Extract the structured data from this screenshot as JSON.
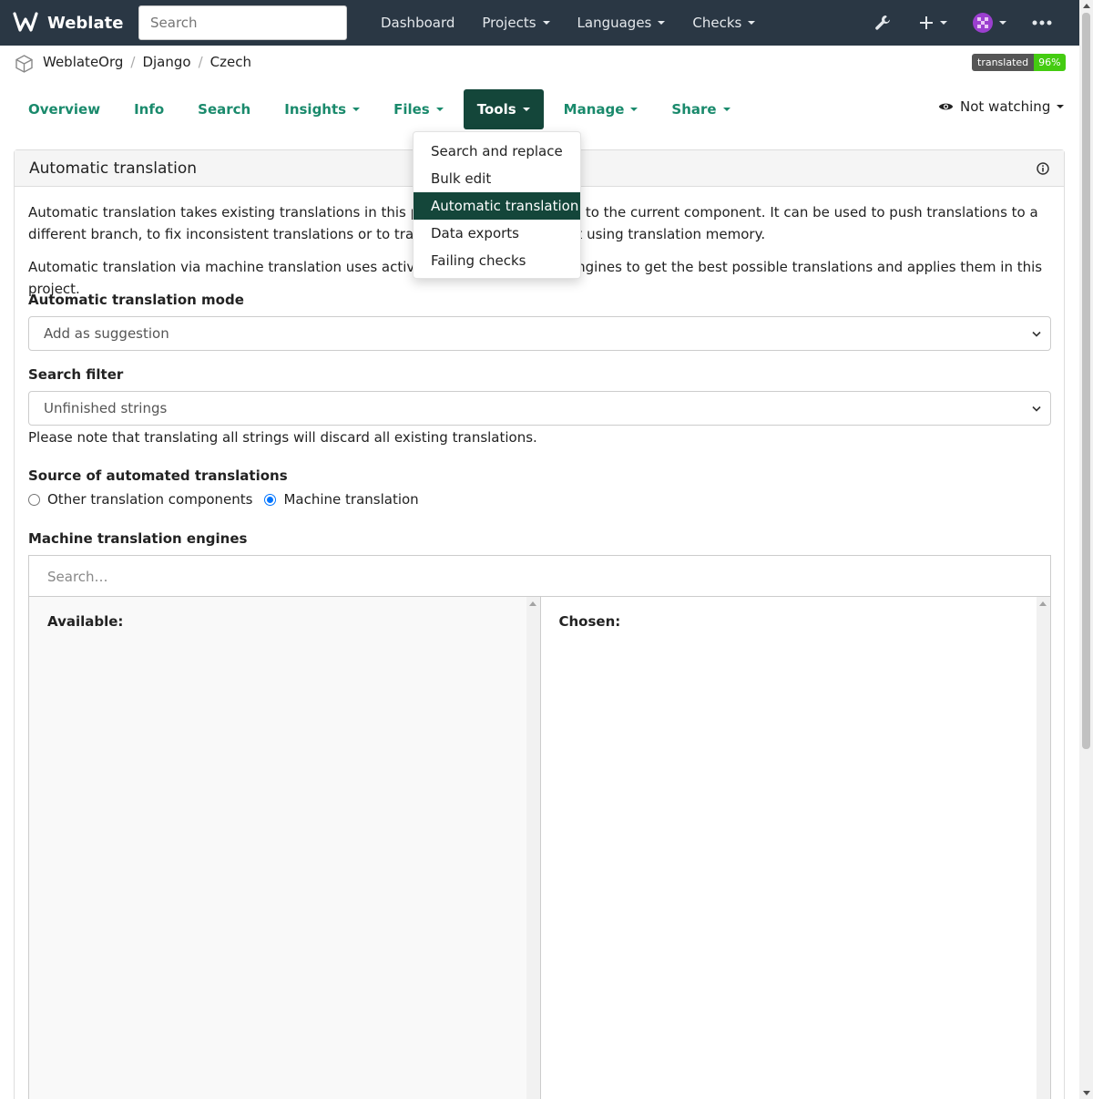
{
  "navbar": {
    "brand": "Weblate",
    "search_placeholder": "Search",
    "menu": [
      {
        "label": "Dashboard",
        "has_caret": false
      },
      {
        "label": "Projects",
        "has_caret": true
      },
      {
        "label": "Languages",
        "has_caret": true
      },
      {
        "label": "Checks",
        "has_caret": true
      }
    ],
    "icons": [
      "wrench-icon",
      "plus-icon",
      "avatar",
      "more-icon"
    ]
  },
  "breadcrumb": {
    "items": [
      "WeblateOrg",
      "Django",
      "Czech"
    ],
    "badge_label": "translated",
    "badge_value": "96%"
  },
  "tabs": [
    {
      "label": "Overview",
      "caret": false,
      "active": false
    },
    {
      "label": "Info",
      "caret": false,
      "active": false
    },
    {
      "label": "Search",
      "caret": false,
      "active": false
    },
    {
      "label": "Insights",
      "caret": true,
      "active": false
    },
    {
      "label": "Files",
      "caret": true,
      "active": false
    },
    {
      "label": "Tools",
      "caret": true,
      "active": true
    },
    {
      "label": "Manage",
      "caret": true,
      "active": false
    },
    {
      "label": "Share",
      "caret": true,
      "active": false
    }
  ],
  "watch": {
    "label": "Not watching"
  },
  "tools_menu": {
    "items": [
      "Search and replace",
      "Bulk edit",
      "Automatic translation",
      "Data exports",
      "Failing checks"
    ],
    "active_index": 2
  },
  "panel": {
    "title": "Automatic translation",
    "para1": "Automatic translation takes existing translations in this project and applies them to the current component. It can be used to push translations to a different branch, to fix inconsistent translations or to translate a new component using translation memory.",
    "para2": "Automatic translation via machine translation uses active machine translation engines to get the best possible translations and applies them in this project.",
    "mode_label": "Automatic translation mode",
    "mode_value": "Add as suggestion",
    "filter_label": "Search filter",
    "filter_value": "Unfinished strings",
    "filter_note": "Please note that translating all strings will discard all existing translations.",
    "source_label": "Source of automated translations",
    "source_options": [
      {
        "label": "Other translation components",
        "checked": false
      },
      {
        "label": "Machine translation",
        "checked": true
      }
    ],
    "engines_label": "Machine translation engines",
    "engines_search_placeholder": "Search…",
    "available_label": "Available:",
    "chosen_label": "Chosen:"
  },
  "colors": {
    "navbar": "#2a3744",
    "accent": "#14463a",
    "tab_text": "#1a8a6c",
    "badge_green": "#44cc11"
  }
}
